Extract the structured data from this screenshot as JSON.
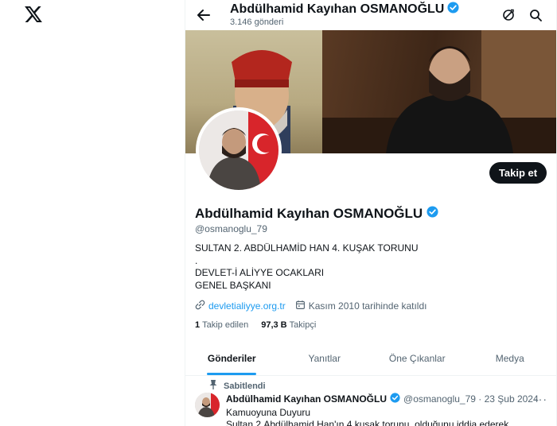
{
  "brand": {
    "logo": "x-logo"
  },
  "topbar": {
    "back_icon": "arrow-left-icon",
    "name": "Abdülhamid Kayıhan OSMANOĞLU",
    "post_count": "3.146 gönderi",
    "icons": [
      "refresh-icon",
      "search-icon"
    ]
  },
  "profile": {
    "follow_label": "Takip et",
    "name": "Abdülhamid Kayıhan OSMANOĞLU",
    "handle": "@osmanoglu_79",
    "bio": [
      "SULTAN 2. ABDÜLHAMİD HAN 4. KUŞAK TORUNU",
      ".",
      "DEVLET-İ ALİYYE OCAKLARI",
      "GENEL BAŞKANI"
    ],
    "website": "devletialiyye.org.tr",
    "joined": "Kasım 2010 tarihinde katıldı",
    "following_count": "1",
    "following_label": "Takip edilen",
    "followers_count": "97,3 B",
    "followers_label": "Takipçi",
    "verified_color": "#1d9bf0"
  },
  "tabs": [
    "Gönderiler",
    "Yanıtlar",
    "Öne Çıkanlar",
    "Medya"
  ],
  "active_tab": "Gönderiler",
  "pinned_tweet": {
    "pinned_label": "Sabitlendi",
    "author": "Abdülhamid Kayıhan OSMANOĞLU",
    "handle_date": "@osmanoglu_79 · 23 Şub 2024",
    "more": "···",
    "line1": "Kamuoyuna Duyuru",
    "line2": "Sultan 2.Abdülhamid Han'ın 4.kuşak torunu, olduğunu iddia ederek"
  },
  "colors": {
    "accent": "#1d9bf0",
    "text": "#0f1419",
    "muted": "#536471"
  }
}
